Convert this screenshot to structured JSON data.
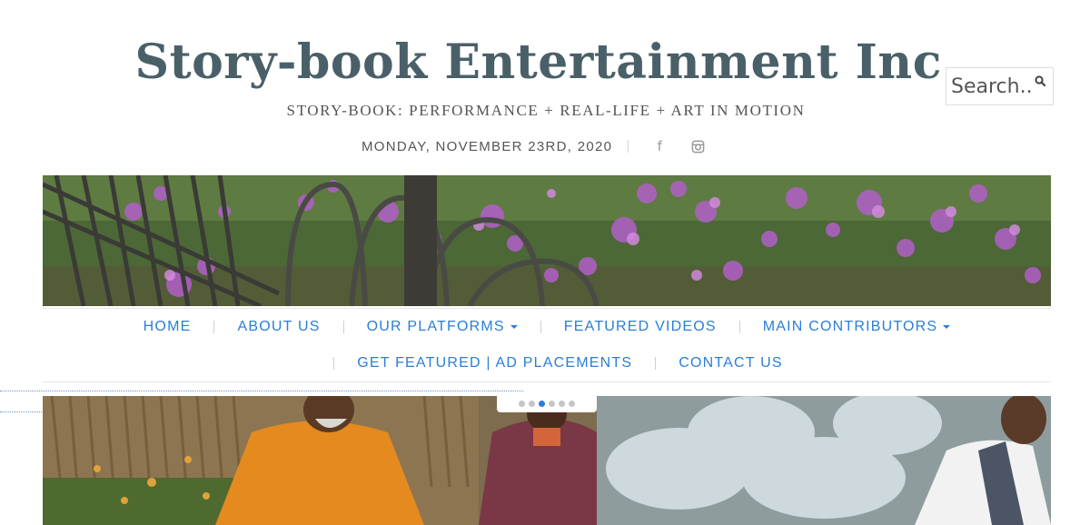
{
  "site": {
    "title": "Story-book Entertainment Inc.",
    "tagline": "STORY-BOOK: PERFORMANCE + REAL-LIFE + ART IN MOTION",
    "date": "MONDAY, NOVEMBER 23RD, 2020"
  },
  "social": [
    "facebook-icon",
    "instagram-icon"
  ],
  "search": {
    "placeholder": "Search..."
  },
  "nav": {
    "row1": [
      {
        "label": "HOME",
        "dropdown": false
      },
      {
        "label": "ABOUT US",
        "dropdown": false
      },
      {
        "label": "OUR PLATFORMS",
        "dropdown": true
      },
      {
        "label": "FEATURED VIDEOS",
        "dropdown": false
      },
      {
        "label": "MAIN CONTRIBUTORS",
        "dropdown": true
      }
    ],
    "row2": [
      {
        "label": "GET FEATURED | AD PLACEMENTS",
        "dropdown": false
      },
      {
        "label": "CONTACT US",
        "dropdown": false
      }
    ]
  },
  "slider": {
    "slide_count": 6,
    "active_index": 2
  },
  "colors": {
    "title": "#4a6068",
    "text": "#555555",
    "link": "#2a7ed8",
    "dot_inactive": "#c5c5c5"
  }
}
